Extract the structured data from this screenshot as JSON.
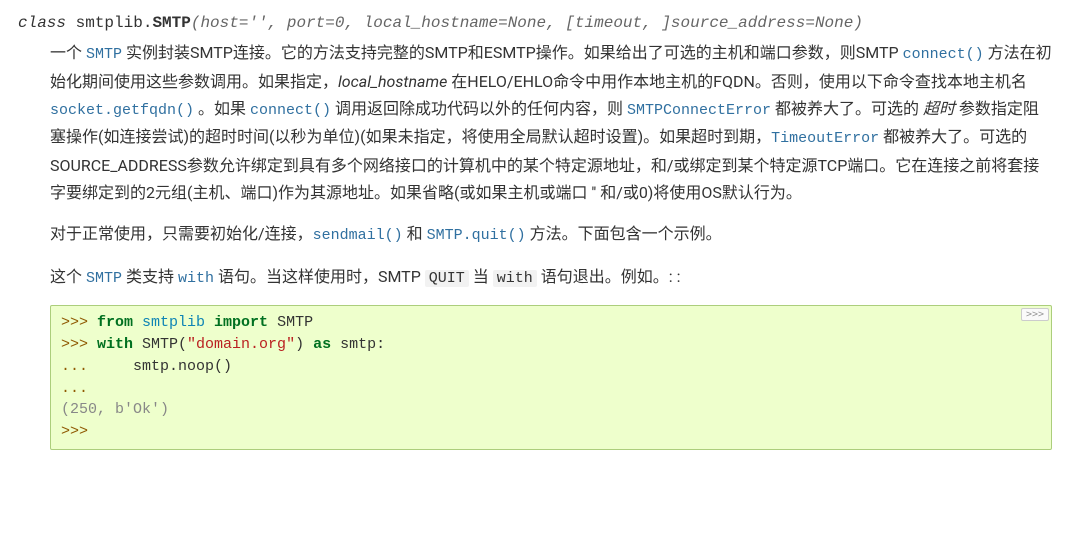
{
  "signature": {
    "keyword": "class",
    "module": "smtplib.",
    "name": "SMTP",
    "params": "(host='', port=0, local_hostname=None, [timeout, ]source_address=None)"
  },
  "desc": {
    "t1a": "一个 ",
    "link_smtp": "SMTP",
    "t1b": " 实例封装SMTP连接。它的方法支持完整的SMTP和ESMTP操作。如果给出了可选的主机和端口参数，则SMTP ",
    "link_connect1": "connect()",
    "t1c": " 方法在初始化期间使用这些参数调用。如果指定，",
    "param_local_hostname": "local_hostname",
    "t1d": " 在HELO/EHLO命令中用作本地主机的FQDN。否则，使用以下命令查找本地主机名 ",
    "link_getfqdn": "socket.getfqdn()",
    "t1e": " 。如果 ",
    "link_connect2": "connect()",
    "t1f": " 调用返回除成功代码以外的任何内容，则 ",
    "link_smtpconnecterror": "SMTPConnectError",
    "t1g": " 都被养大了。可选的 ",
    "param_timeout": "超时",
    "t1h": " 参数指定阻塞操作(如连接尝试)的超时时间(以秒为单位)(如果未指定，将使用全局默认超时设置)。如果超时到期，",
    "link_timeouterror": "TimeoutError",
    "t1i": " 都被养大了。可选的SOURCE_ADDRESS参数允许绑定到具有多个网络接口的计算机中的某个特定源地址，和/或绑定到某个特定源TCP端口。它在连接之前将套接字要绑定到的2元组(主机、端口)作为其源地址。如果省略(或如果主机或端口 '' 和/或0)将使用OS默认行为。"
  },
  "p2": {
    "t2a": "对于正常使用，只需要初始化/连接，",
    "link_sendmail": "sendmail()",
    "t2b": " 和 ",
    "link_quit": "SMTP.quit()",
    "t2c": " 方法。下面包含一个示例。"
  },
  "p3": {
    "t3a": "这个 ",
    "link_smtp2": "SMTP",
    "t3b": " 类支持 ",
    "link_with": "with",
    "t3c": " 语句。当这样使用时，SMTP ",
    "code_quit": "QUIT",
    "t3d": " 当 ",
    "code_with": "with",
    "t3e": " 语句退出。例如。: :"
  },
  "code": {
    "l1_prompt": ">>> ",
    "l1_kw1": "from",
    "l1_mod": " smtplib ",
    "l1_kw2": "import",
    "l1_name": " SMTP",
    "l2_prompt": ">>> ",
    "l2_kw": "with",
    "l2_call": " SMTP(",
    "l2_str": "\"domain.org\"",
    "l2_rest": ") ",
    "l2_as": "as",
    "l2_var": " smtp:",
    "l3_prompt": "... ",
    "l3_body": "    smtp.noop()",
    "l4_prompt": "...",
    "l5_out": "(250, b'Ok')",
    "l6_prompt": ">>>"
  },
  "copy_label": ">>>"
}
